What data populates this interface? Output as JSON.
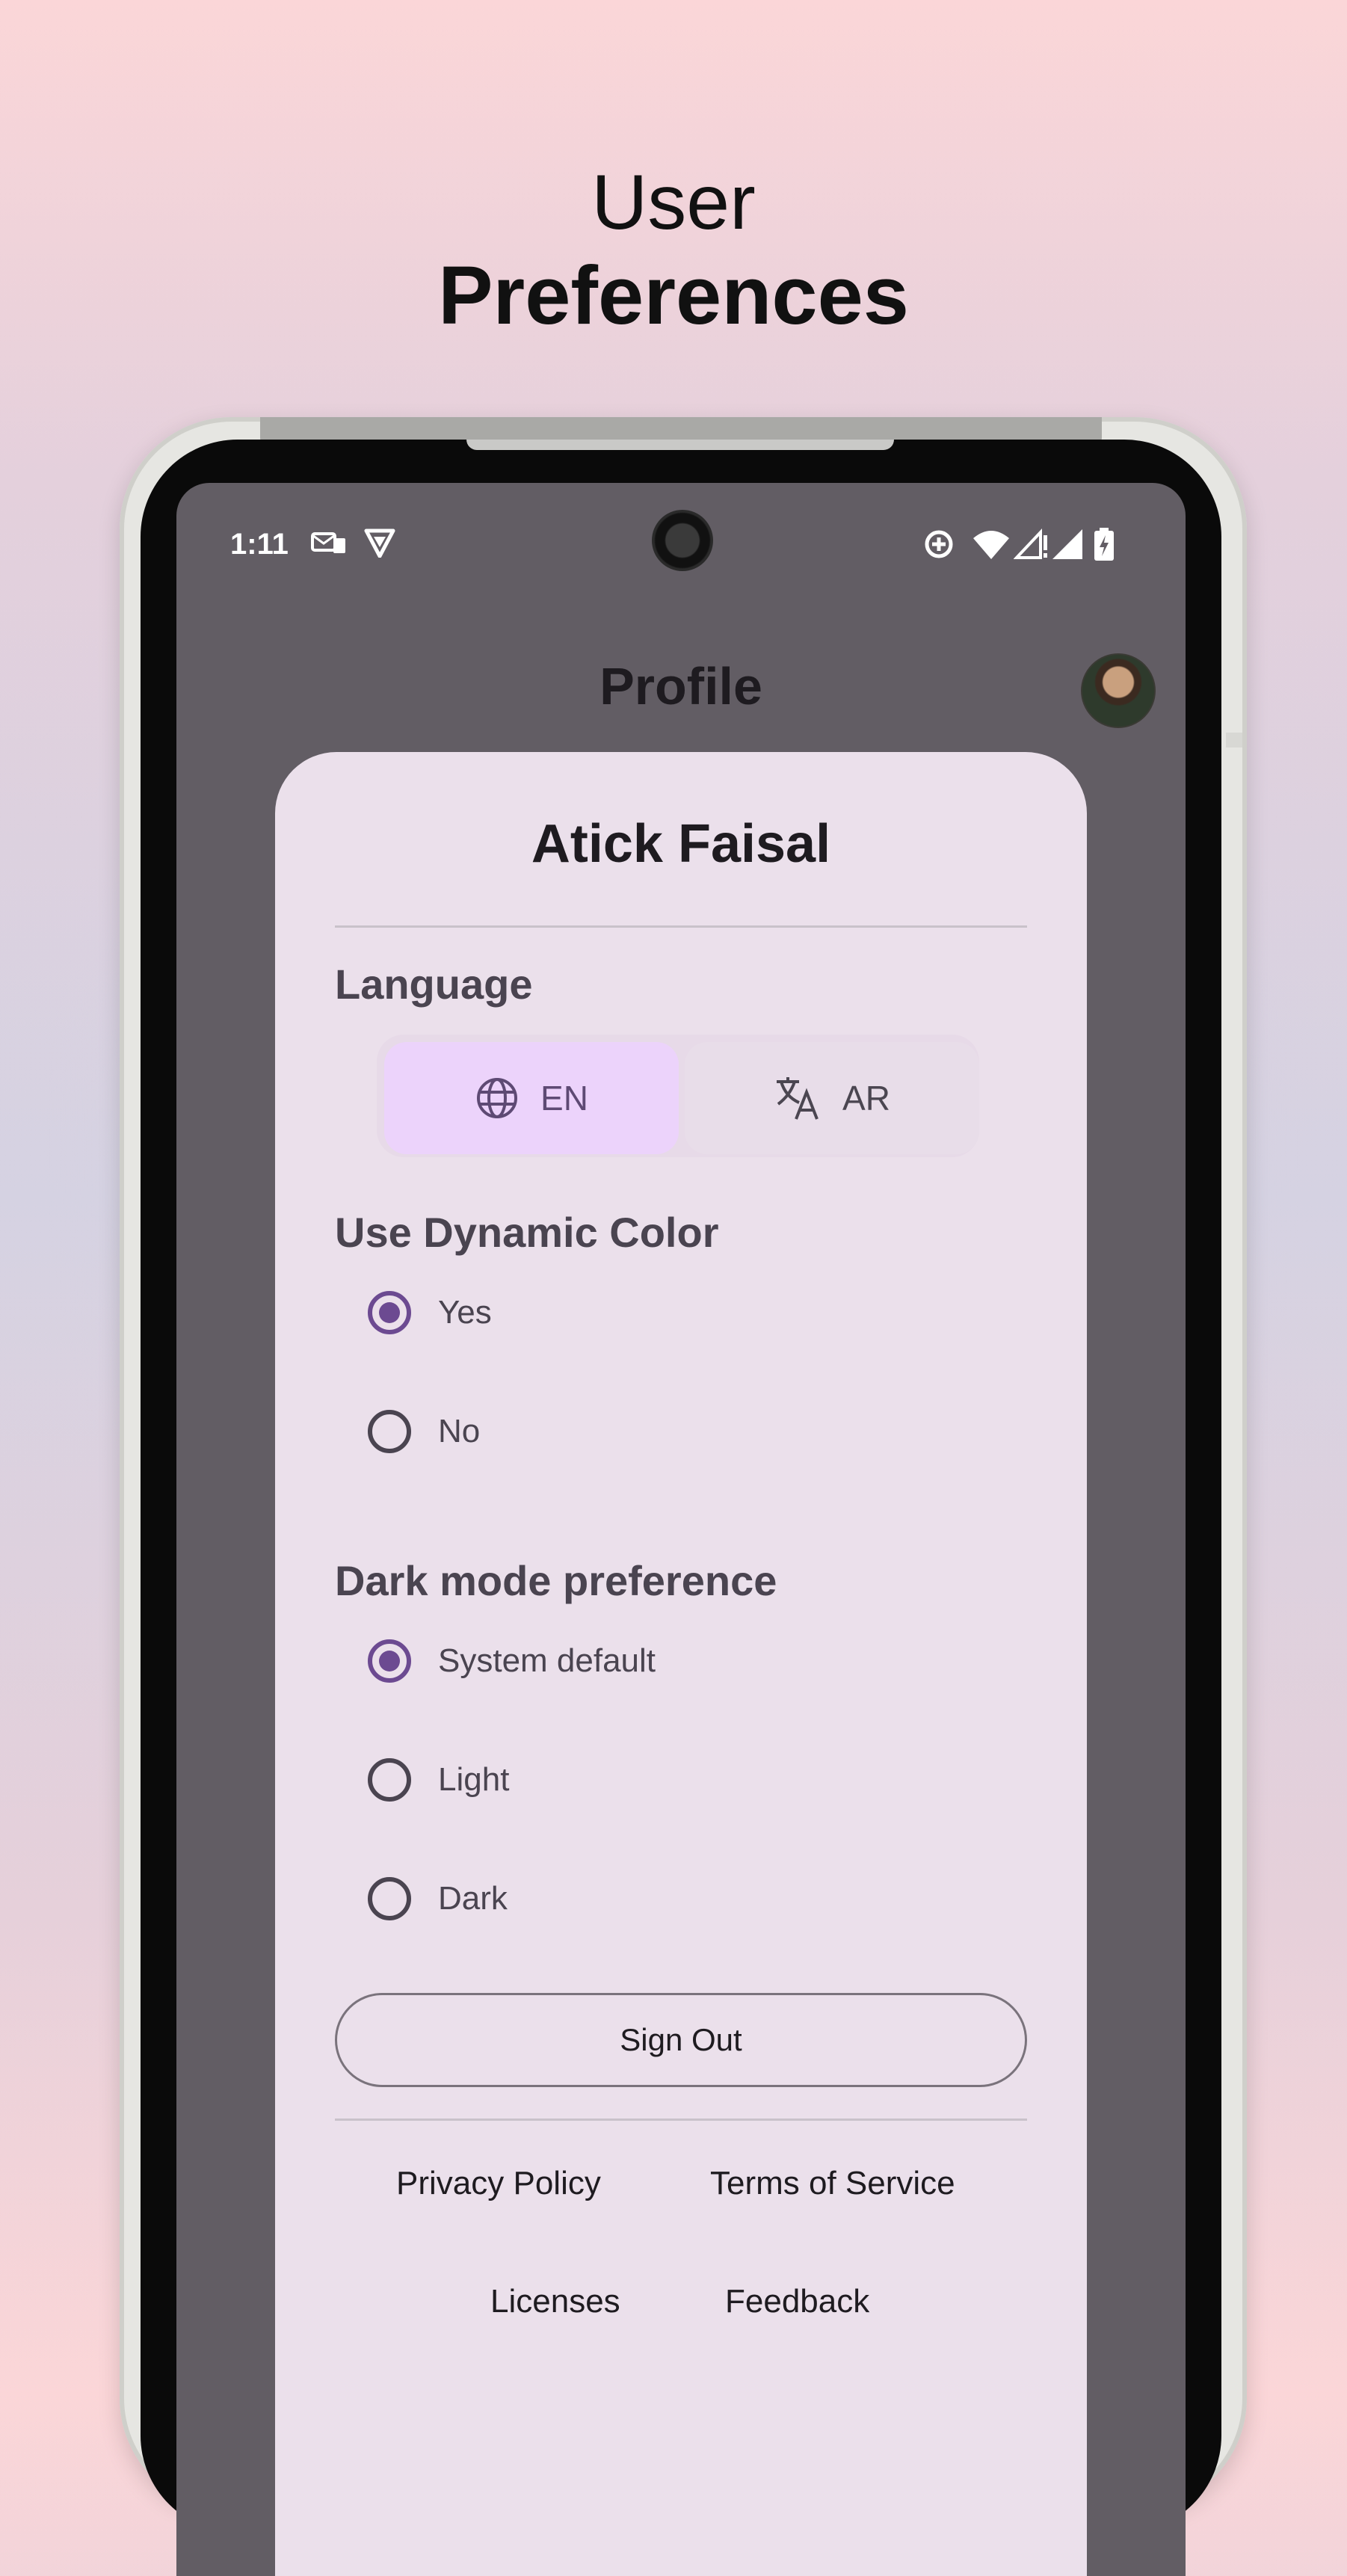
{
  "hero": {
    "line1": "User",
    "line2": "Preferences"
  },
  "status_bar": {
    "time": "1:11",
    "left_icons": [
      "mail-notification-icon",
      "vpn-shield-icon"
    ],
    "right_icons": [
      "data-saver-icon",
      "wifi-icon",
      "signal-no-data-icon",
      "signal-icon",
      "battery-charging-icon"
    ]
  },
  "header": {
    "title": "Profile",
    "avatar": "user-avatar"
  },
  "profile_card": {
    "user_name": "Atick Faisal",
    "language": {
      "title": "Language",
      "options": [
        {
          "label": "EN",
          "icon": "globe-icon",
          "selected": true
        },
        {
          "label": "AR",
          "icon": "translate-icon",
          "selected": false
        }
      ]
    },
    "dynamic_color": {
      "title": "Use Dynamic Color",
      "options": [
        {
          "label": "Yes",
          "selected": true
        },
        {
          "label": "No",
          "selected": false
        }
      ]
    },
    "dark_mode": {
      "title": "Dark mode preference",
      "options": [
        {
          "label": "System default",
          "selected": true
        },
        {
          "label": "Light",
          "selected": false
        },
        {
          "label": "Dark",
          "selected": false
        }
      ]
    },
    "sign_out_label": "Sign Out",
    "links": {
      "privacy": "Privacy Policy",
      "terms": "Terms of Service",
      "licenses": "Licenses",
      "feedback": "Feedback"
    }
  },
  "colors": {
    "accent": "#6c4a91",
    "selected_segment": "#ecd3fb",
    "card_background": "#ebe0eb",
    "screen_scrim": "#625d64"
  }
}
